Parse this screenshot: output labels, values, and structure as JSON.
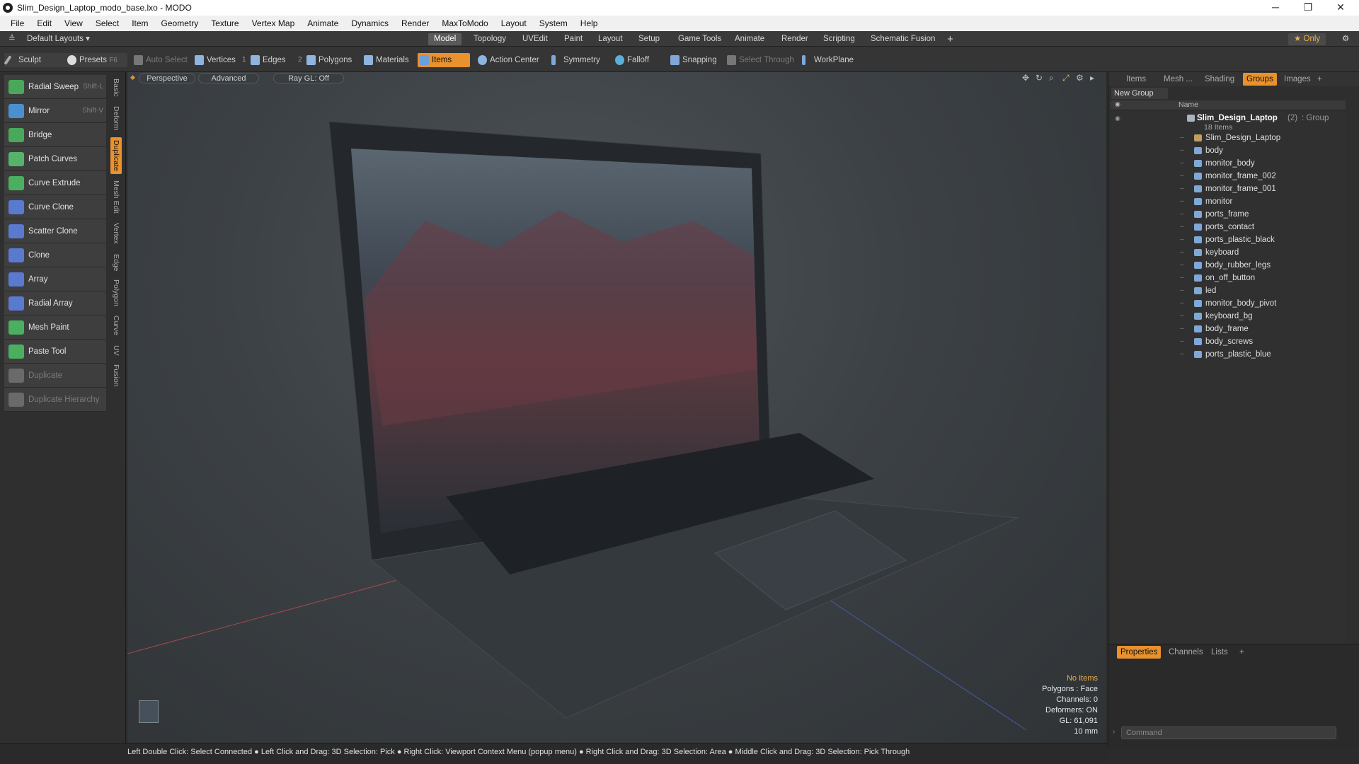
{
  "window": {
    "title": "Slim_Design_Laptop_modo_base.lxo - MODO",
    "controls": [
      "─",
      "❐",
      "✕"
    ]
  },
  "menubar": [
    "File",
    "Edit",
    "View",
    "Select",
    "Item",
    "Geometry",
    "Texture",
    "Vertex Map",
    "Animate",
    "Dynamics",
    "Render",
    "MaxToModo",
    "Layout",
    "System",
    "Help"
  ],
  "layoutbar": {
    "layouts_label": "Default Layouts ▾",
    "tabs": [
      "Model",
      "Topology",
      "UVEdit",
      "Paint",
      "Layout",
      "Setup",
      "Game Tools",
      "Animate",
      "Render",
      "Scripting",
      "Schematic Fusion"
    ],
    "active_tab": "Model",
    "add": "+",
    "only_label": "★  Only",
    "settings": "⚙"
  },
  "toolrow": {
    "sculpt": "Sculpt",
    "presets": "Presets",
    "presets_key": "F6",
    "auto_select": "Auto Select",
    "vertices": "Vertices",
    "vertices_num": "1",
    "edges": "Edges",
    "edges_num": "2",
    "polygons": "Polygons",
    "materials": "Materials",
    "items": "Items",
    "action_center": "Action Center",
    "symmetry": "Symmetry",
    "falloff": "Falloff",
    "snapping": "Snapping",
    "select_through": "Select Through",
    "workplane": "WorkPlane"
  },
  "tools": [
    {
      "label": "Radial Sweep",
      "shortcut": "Shift-L",
      "color": "#4aa85a"
    },
    {
      "label": "Mirror",
      "shortcut": "Shift-V",
      "color": "#4a8fd0"
    },
    {
      "label": "Bridge",
      "shortcut": "",
      "color": "#4aa85a"
    },
    {
      "label": "Patch Curves",
      "shortcut": "",
      "color": "#56b46a"
    },
    {
      "label": "Curve Extrude",
      "shortcut": "",
      "color": "#4ab060"
    },
    {
      "label": "Curve Clone",
      "shortcut": "",
      "color": "#5a7ad0"
    },
    {
      "label": "Scatter Clone",
      "shortcut": "",
      "color": "#5a7ad0"
    },
    {
      "label": "Clone",
      "shortcut": "",
      "color": "#5a7ad0"
    },
    {
      "label": "Array",
      "shortcut": "",
      "color": "#5a7ad0"
    },
    {
      "label": "Radial Array",
      "shortcut": "",
      "color": "#5a7ad0"
    },
    {
      "label": "Mesh Paint",
      "shortcut": "",
      "color": "#4ab060"
    },
    {
      "label": "Paste Tool",
      "shortcut": "",
      "color": "#4ab060"
    },
    {
      "label": "Duplicate",
      "shortcut": "",
      "color": "#6a6a6a"
    },
    {
      "label": "Duplicate Hierarchy",
      "shortcut": "",
      "color": "#6a6a6a"
    }
  ],
  "vtabs": [
    "Basic",
    "Deform",
    "Duplicate",
    "Mesh Edit",
    "Vertex",
    "Edge",
    "Polygon",
    "Curve",
    "UV",
    "Fusion"
  ],
  "viewport": {
    "view": "Perspective",
    "shading": "Advanced",
    "raygl": "Ray GL: Off",
    "info": {
      "selection": "No Items",
      "polygons": "Polygons : Face",
      "channels": "Channels: 0",
      "deformers": "Deformers: ON",
      "gl": "GL: 61,091",
      "units": "10 mm"
    }
  },
  "rightpanel": {
    "tabs": [
      "Items",
      "Mesh ...",
      "Shading",
      "Groups",
      "Images",
      "+"
    ],
    "active": "Groups",
    "new_group": "New Group",
    "name_col": "Name",
    "group": {
      "name": "Slim_Design_Laptop",
      "count": "(2)",
      "type": ": Group",
      "sub": "18 Items"
    },
    "items": [
      "Slim_Design_Laptop",
      "body",
      "monitor_body",
      "monitor_frame_002",
      "monitor_frame_001",
      "monitor",
      "ports_frame",
      "ports_contact",
      "ports_plastic_black",
      "keyboard",
      "body_rubber_legs",
      "on_off_button",
      "led",
      "monitor_body_pivot",
      "keyboard_bg",
      "body_frame",
      "body_screws",
      "ports_plastic_blue"
    ],
    "lower_tabs": [
      "Properties",
      "Channels",
      "Lists",
      "+"
    ],
    "command_placeholder": "Command"
  },
  "statusbar": "Left Double Click: Select Connected ● Left Click and Drag: 3D Selection: Pick ● Right Click: Viewport Context Menu (popup menu) ● Right Click and Drag: 3D Selection: Area ● Middle Click and Drag: 3D Selection: Pick Through"
}
